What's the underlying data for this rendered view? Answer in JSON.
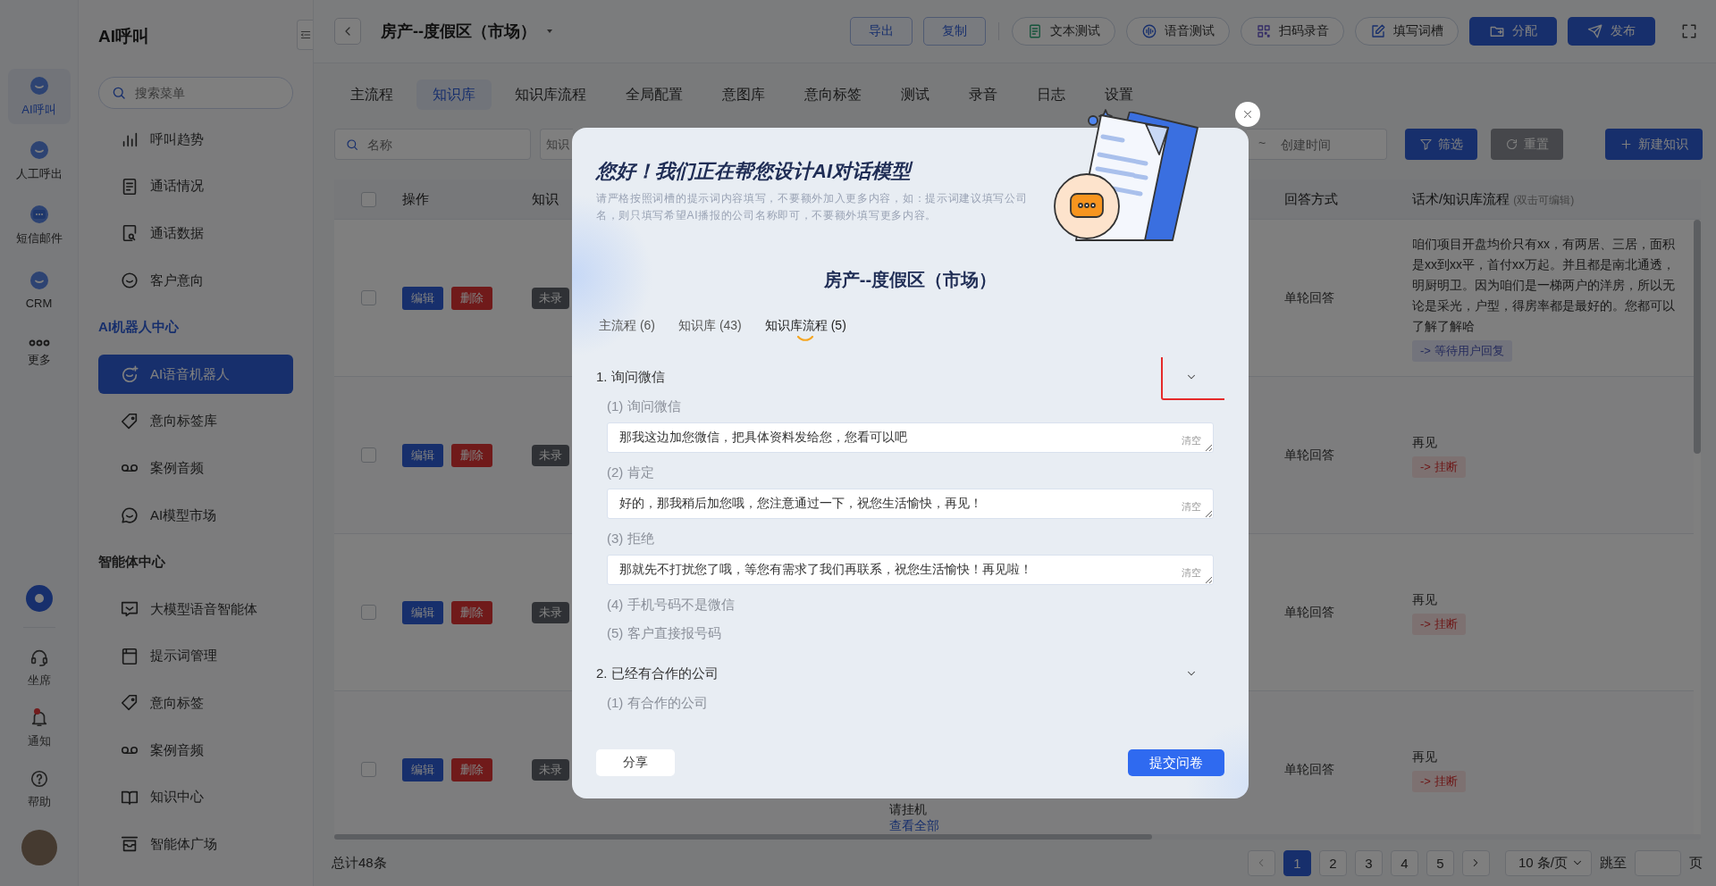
{
  "rail": {
    "items": [
      {
        "label": "AI呼叫",
        "selected": true
      },
      {
        "label": "人工呼出",
        "selected": false
      },
      {
        "label": "短信邮件",
        "selected": false
      },
      {
        "label": "CRM",
        "selected": false
      },
      {
        "label": "更多",
        "selected": false
      }
    ],
    "bottom": [
      {
        "label": "坐席",
        "badge": false
      },
      {
        "label": "通知",
        "badge": true
      },
      {
        "label": "帮助",
        "badge": false
      }
    ]
  },
  "sidebar": {
    "title": "AI呼叫",
    "search": {
      "placeholder": "搜索菜单"
    },
    "sections": [
      {
        "items": [
          {
            "label": "呼叫趋势",
            "selected": false
          },
          {
            "label": "通话情况",
            "selected": false
          },
          {
            "label": "通话数据",
            "selected": false
          },
          {
            "label": "客户意向",
            "selected": false
          }
        ]
      },
      {
        "heading": "AI机器人中心",
        "items": [
          {
            "label": "AI语音机器人",
            "selected": true
          },
          {
            "label": "意向标签库",
            "selected": false
          },
          {
            "label": "案例音频",
            "selected": false
          },
          {
            "label": "AI模型市场",
            "selected": false
          }
        ]
      },
      {
        "heading": "智能体中心",
        "items": [
          {
            "label": "大模型语音智能体",
            "selected": false
          },
          {
            "label": "提示词管理",
            "selected": false
          },
          {
            "label": "意向标签",
            "selected": false
          },
          {
            "label": "案例音频",
            "selected": false
          },
          {
            "label": "知识中心",
            "selected": false
          },
          {
            "label": "智能体广场",
            "selected": false
          }
        ]
      }
    ]
  },
  "header": {
    "title": "房产--度假区（市场）",
    "buttons": [
      {
        "label": "导出",
        "kind": "outline"
      },
      {
        "label": "复制",
        "kind": "outline"
      },
      {
        "label": "文本测试",
        "kind": "pill"
      },
      {
        "label": "语音测试",
        "kind": "pill"
      },
      {
        "label": "扫码录音",
        "kind": "pill"
      },
      {
        "label": "填写词槽",
        "kind": "pill"
      },
      {
        "label": "分配",
        "kind": "primary"
      },
      {
        "label": "发布",
        "kind": "primary"
      }
    ]
  },
  "tabs": [
    {
      "label": "主流程",
      "selected": false
    },
    {
      "label": "知识库",
      "selected": true
    },
    {
      "label": "知识库流程",
      "selected": false
    },
    {
      "label": "全局配置",
      "selected": false
    },
    {
      "label": "意图库",
      "selected": false
    },
    {
      "label": "意向标签",
      "selected": false
    },
    {
      "label": "测试",
      "selected": false
    },
    {
      "label": "录音",
      "selected": false
    },
    {
      "label": "日志",
      "selected": false
    },
    {
      "label": "设置",
      "selected": false
    }
  ],
  "filters": {
    "name": {
      "placeholder": "名称"
    },
    "knowledge": {
      "placeholder": "知识"
    },
    "date": {
      "separator": "~",
      "placeholder": "创建时间"
    },
    "buttons": [
      {
        "label": "筛选",
        "kind": "filter"
      },
      {
        "label": "重置",
        "kind": "reset"
      },
      {
        "label": "新建知识",
        "kind": "create"
      }
    ]
  },
  "table": {
    "header_checked": false,
    "columns": [
      {
        "label": "操作"
      },
      {
        "label": "知识"
      },
      {
        "label": "回答方式"
      },
      {
        "label": "话术/知识库流程",
        "note": "(双击可编辑)"
      }
    ],
    "rows": [
      {
        "checked": false,
        "actions": [
          {
            "label": "编辑",
            "kind": "edit"
          },
          {
            "label": "删除",
            "kind": "delete"
          }
        ],
        "status": "未录",
        "answer_mode": "单轮回答",
        "script": "咱们项目开盘均价只有xx，有两居、三居，面积是xx到xx平，首付xx万起。并且都是南北通透，明厨明卫。因为咱们是一梯两户的洋房，所以无论是采光，户型，得房率都是最好的。您都可以了解了解哈",
        "next": {
          "label": "-> 等待用户回复",
          "kind": "wait"
        }
      },
      {
        "checked": false,
        "actions": [
          {
            "label": "编辑",
            "kind": "edit"
          },
          {
            "label": "删除",
            "kind": "delete"
          }
        ],
        "status": "未录",
        "answer_mode": "单轮回答",
        "script": "再见",
        "next": {
          "label": "-> 挂断",
          "kind": "hangup"
        }
      },
      {
        "checked": false,
        "actions": [
          {
            "label": "编辑",
            "kind": "edit"
          },
          {
            "label": "删除",
            "kind": "delete"
          }
        ],
        "status": "未录",
        "answer_mode": "单轮回答",
        "script": "再见",
        "next": {
          "label": "-> 挂断",
          "kind": "hangup"
        }
      },
      {
        "checked": false,
        "actions": [
          {
            "label": "编辑",
            "kind": "edit"
          },
          {
            "label": "删除",
            "kind": "delete"
          }
        ],
        "status": "未录",
        "column_3": {
          "text": "请挂机",
          "link": "查看全部"
        },
        "answer_mode": "单轮回答",
        "script": "再见",
        "next": {
          "label": "-> 挂断",
          "kind": "hangup"
        }
      }
    ]
  },
  "pagination": {
    "total": "总计48条",
    "pages": [
      {
        "label": "1",
        "selected": true
      },
      {
        "label": "2",
        "selected": false
      },
      {
        "label": "3",
        "selected": false
      },
      {
        "label": "4",
        "selected": false
      },
      {
        "label": "5",
        "selected": false
      }
    ],
    "page_size": "10 条/页",
    "jump_label": "跳至",
    "jump_suffix": "页"
  },
  "modal": {
    "heading": "您好！我们正在帮您设计AI对话模型",
    "note": "请严格按照词槽的提示词内容填写，不要额外加入更多内容，如：提示词建议填写公司名，则只填写希望AI播报的公司名称即可，不要额外填写更多内容。",
    "title": "房产--度假区（市场）",
    "tabs": [
      {
        "label": "主流程 (6)",
        "selected": false
      },
      {
        "label": "知识库 (43)",
        "selected": false
      },
      {
        "label": "知识库流程 (5)",
        "selected": true
      }
    ],
    "sections": [
      {
        "title": "1. 询问微信",
        "expanded": true,
        "highlighted": true,
        "items": [
          {
            "label": "(1) 询问微信",
            "value": "那我这边加您微信，把具体资料发给您，您看可以吧",
            "clear": "清空"
          },
          {
            "label": "(2) 肯定",
            "value": "好的，那我稍后加您哦，您注意通过一下，祝您生活愉快，再见！",
            "clear": "清空"
          },
          {
            "label": "(3) 拒绝",
            "value": "那就先不打扰您了哦，等您有需求了我们再联系，祝您生活愉快！再见啦！",
            "clear": "清空"
          },
          {
            "label": "(4) 手机号码不是微信"
          },
          {
            "label": "(5) 客户直接报号码"
          }
        ]
      },
      {
        "title": "2. 已经有合作的公司",
        "expanded": true,
        "highlighted": false,
        "items": [
          {
            "label": "(1) 有合作的公司"
          }
        ]
      }
    ],
    "share": "分享",
    "submit": "提交问卷"
  }
}
